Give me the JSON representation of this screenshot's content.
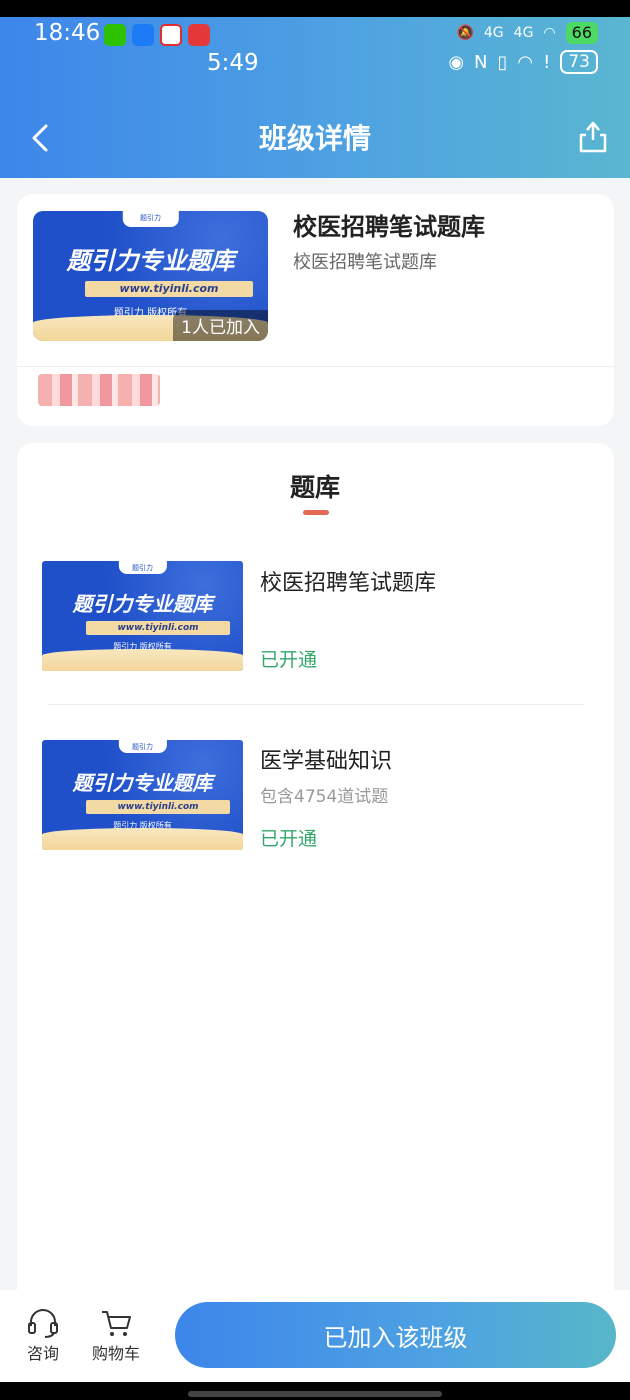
{
  "status_bar": {
    "time_primary": "18:46",
    "time_secondary": "5:49",
    "signal_label_1": "4G",
    "signal_label_2": "4G",
    "battery_primary": "66",
    "battery_secondary": "73"
  },
  "header": {
    "title": "班级详情"
  },
  "banner": {
    "heading": "题引力专业题库",
    "url": "www.tiyinli.com",
    "copyright": "题引力 版权所有",
    "brand": "题引力"
  },
  "class_info": {
    "title": "校医招聘笔试题库",
    "subtitle": "校医招聘笔试题库",
    "joined_count": "1人已加入"
  },
  "section": {
    "title": "题库"
  },
  "question_banks": [
    {
      "title": "校医招聘笔试题库",
      "description": "",
      "status": "已开通"
    },
    {
      "title": "医学基础知识",
      "description": "包含4754道试题",
      "status": "已开通"
    }
  ],
  "bottom_bar": {
    "consult_label": "咨询",
    "cart_label": "购物车",
    "join_button": "已加入该班级"
  },
  "colors": {
    "header_gradient_start": "#3d86ea",
    "header_gradient_end": "#5ab6d1",
    "status_green": "#33a66a",
    "accent_underline": "#e06b52"
  }
}
